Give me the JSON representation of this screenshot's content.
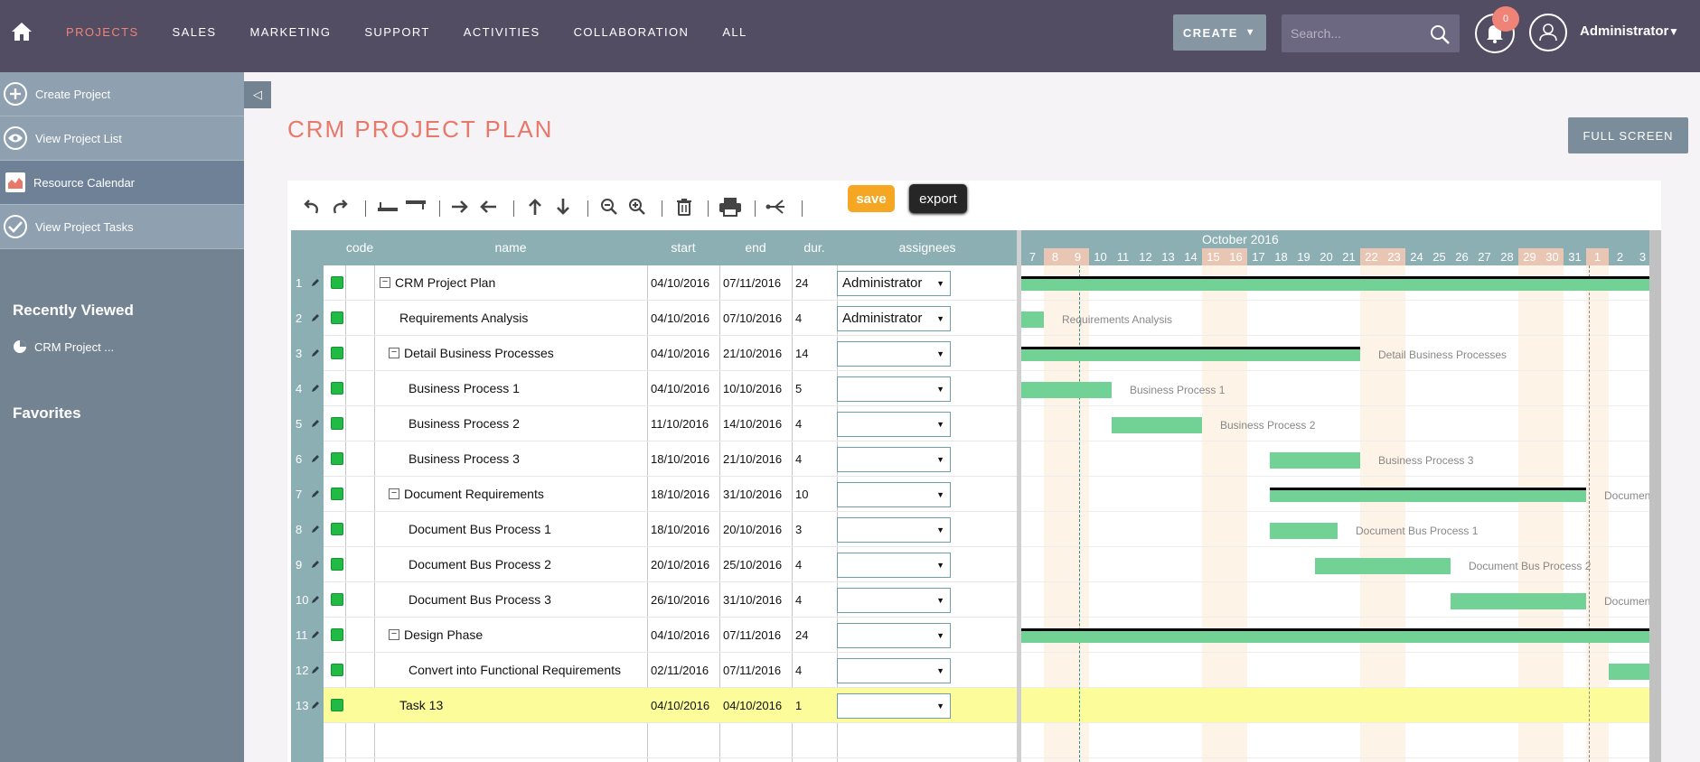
{
  "nav": {
    "items": [
      "PROJECTS",
      "SALES",
      "MARKETING",
      "SUPPORT",
      "ACTIVITIES",
      "COLLABORATION",
      "ALL"
    ],
    "active": "PROJECTS",
    "create_label": "CREATE",
    "search_placeholder": "Search...",
    "notification_count": "0",
    "user_name": "Administrator"
  },
  "sidebar": {
    "actions": [
      {
        "label": "Create Project",
        "icon": "plus-icon"
      },
      {
        "label": "View Project List",
        "icon": "eye-icon"
      },
      {
        "label": "Resource Calendar",
        "icon": "chart-icon"
      },
      {
        "label": "View Project Tasks",
        "icon": "check-icon"
      }
    ],
    "recently_viewed_title": "Recently Viewed",
    "recent_items": [
      "CRM Project ..."
    ],
    "favorites_title": "Favorites"
  },
  "page": {
    "title": "CRM PROJECT PLAN",
    "fullscreen_label": "FULL SCREEN"
  },
  "toolbar": {
    "save_label": "save",
    "export_label": "export"
  },
  "grid": {
    "headers": {
      "code": "code",
      "name": "name",
      "start": "start",
      "end": "end",
      "dur": "dur.",
      "assignees": "assignees"
    },
    "rows": [
      {
        "num": "1",
        "name": "CRM Project Plan",
        "level": 0,
        "collapse": true,
        "start": "04/10/2016",
        "end": "07/11/2016",
        "dur": "24",
        "assignee": "Administrator"
      },
      {
        "num": "2",
        "name": "Requirements Analysis",
        "level": 1,
        "collapse": false,
        "start": "04/10/2016",
        "end": "07/10/2016",
        "dur": "4",
        "assignee": "Administrator"
      },
      {
        "num": "3",
        "name": "Detail Business Processes",
        "level": 1,
        "collapse": true,
        "start": "04/10/2016",
        "end": "21/10/2016",
        "dur": "14",
        "assignee": ""
      },
      {
        "num": "4",
        "name": "Business Process 1",
        "level": 2,
        "collapse": false,
        "start": "04/10/2016",
        "end": "10/10/2016",
        "dur": "5",
        "assignee": ""
      },
      {
        "num": "5",
        "name": "Business Process 2",
        "level": 2,
        "collapse": false,
        "start": "11/10/2016",
        "end": "14/10/2016",
        "dur": "4",
        "assignee": ""
      },
      {
        "num": "6",
        "name": "Business Process 3",
        "level": 2,
        "collapse": false,
        "start": "18/10/2016",
        "end": "21/10/2016",
        "dur": "4",
        "assignee": ""
      },
      {
        "num": "7",
        "name": "Document Requirements",
        "level": 1,
        "collapse": true,
        "start": "18/10/2016",
        "end": "31/10/2016",
        "dur": "10",
        "assignee": ""
      },
      {
        "num": "8",
        "name": "Document Bus Process 1",
        "level": 2,
        "collapse": false,
        "start": "18/10/2016",
        "end": "20/10/2016",
        "dur": "3",
        "assignee": ""
      },
      {
        "num": "9",
        "name": "Document Bus Process 2",
        "level": 2,
        "collapse": false,
        "start": "20/10/2016",
        "end": "25/10/2016",
        "dur": "4",
        "assignee": ""
      },
      {
        "num": "10",
        "name": "Document Bus Process 3",
        "level": 2,
        "collapse": false,
        "start": "26/10/2016",
        "end": "31/10/2016",
        "dur": "4",
        "assignee": ""
      },
      {
        "num": "11",
        "name": "Design Phase",
        "level": 1,
        "collapse": true,
        "start": "04/10/2016",
        "end": "07/11/2016",
        "dur": "24",
        "assignee": ""
      },
      {
        "num": "12",
        "name": "Convert into Functional Requirements",
        "level": 2,
        "collapse": false,
        "start": "02/11/2016",
        "end": "07/11/2016",
        "dur": "4",
        "assignee": ""
      },
      {
        "num": "13",
        "name": "Task 13",
        "level": 1,
        "collapse": false,
        "start": "04/10/2016",
        "end": "04/10/2016",
        "dur": "1",
        "assignee": "",
        "highlight": true
      }
    ]
  },
  "chart": {
    "month": "October 2016",
    "days": [
      "7",
      "8",
      "9",
      "10",
      "11",
      "12",
      "13",
      "14",
      "15",
      "16",
      "17",
      "18",
      "19",
      "20",
      "21",
      "22",
      "23",
      "24",
      "25",
      "26",
      "27",
      "28",
      "29",
      "30",
      "31",
      "1",
      "2",
      "3"
    ],
    "weekend_days": [
      "8",
      "9",
      "15",
      "16",
      "22",
      "23",
      "29",
      "30",
      "1"
    ],
    "bars": [
      {
        "row": 1,
        "start_day": "4",
        "end_day": "3",
        "parent": true,
        "label": ""
      },
      {
        "row": 2,
        "start_day": "4",
        "end_day": "7",
        "parent": false,
        "label": "Requirements Analysis"
      },
      {
        "row": 3,
        "start_day": "4",
        "end_day": "21",
        "parent": true,
        "label": "Detail Business Processes"
      },
      {
        "row": 4,
        "start_day": "4",
        "end_day": "10",
        "parent": false,
        "label": "Business Process 1"
      },
      {
        "row": 5,
        "start_day": "11",
        "end_day": "14",
        "parent": false,
        "label": "Business Process 2"
      },
      {
        "row": 6,
        "start_day": "18",
        "end_day": "21",
        "parent": false,
        "label": "Business Process 3"
      },
      {
        "row": 7,
        "start_day": "18",
        "end_day": "31",
        "parent": true,
        "label": "Documen"
      },
      {
        "row": 8,
        "start_day": "18",
        "end_day": "20",
        "parent": false,
        "label": "Document Bus Process 1"
      },
      {
        "row": 9,
        "start_day": "20",
        "end_day": "25",
        "parent": false,
        "label": "Document Bus Process 2"
      },
      {
        "row": 10,
        "start_day": "26",
        "end_day": "31",
        "parent": false,
        "label": "Documen"
      },
      {
        "row": 11,
        "start_day": "4",
        "end_day": "3",
        "parent": true,
        "label": ""
      },
      {
        "row": 12,
        "start_day": "2",
        "end_day": "3",
        "parent": false,
        "label": ""
      }
    ]
  },
  "colors": {
    "topbar": "#534d64",
    "accent": "#f08377",
    "sidebar": "#748392",
    "grid_header": "#8cafb4",
    "bar": "#72d195",
    "save": "#f5a623",
    "highlight_row": "#fcfc9a"
  }
}
